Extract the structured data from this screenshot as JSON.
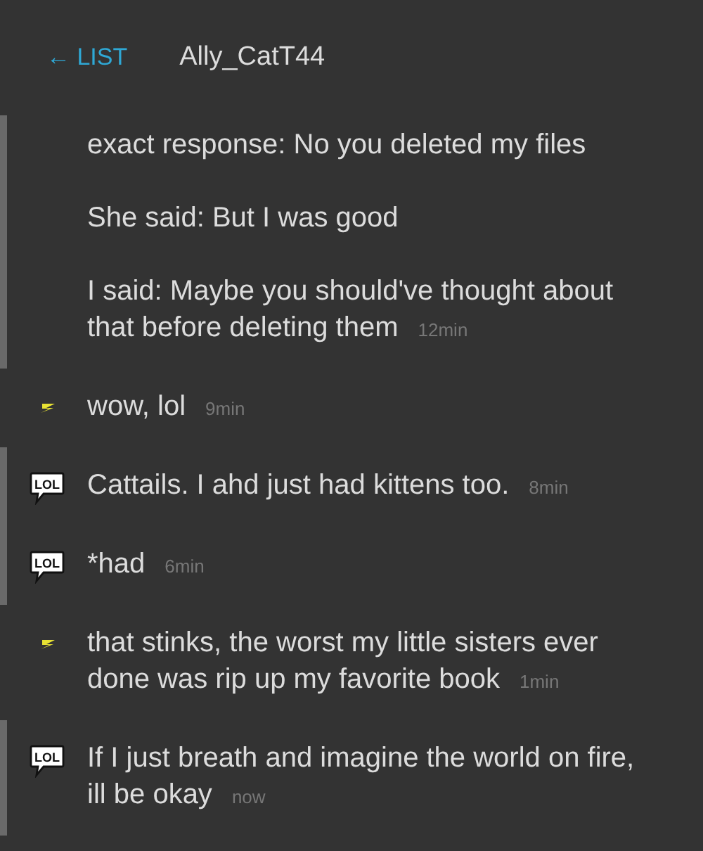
{
  "header": {
    "back_link": "← LIST",
    "title": "Ally_CatT44"
  },
  "messages": [
    {
      "kind": "lol",
      "text": "exact response: No you deleted my files\n\nShe said: But I was good\n\nI said: Maybe you should've thought about\nthat before deleting them",
      "time": "12min"
    },
    {
      "kind": "bolt",
      "text": "wow, lol",
      "time": "9min"
    },
    {
      "kind": "lol",
      "icon_label": "LOL",
      "text": "Cattails. I ahd just had kittens too.",
      "time": "8min"
    },
    {
      "kind": "lol",
      "icon_label": "LOL",
      "text": "*had",
      "time": "6min"
    },
    {
      "kind": "bolt",
      "text": "that stinks, the worst my little sisters ever\ndone was rip up my favorite book",
      "time": "1min"
    },
    {
      "kind": "lol",
      "icon_label": "LOL",
      "text": "If I just breath and imagine the world on fire,\nill be okay",
      "time": "now"
    }
  ]
}
